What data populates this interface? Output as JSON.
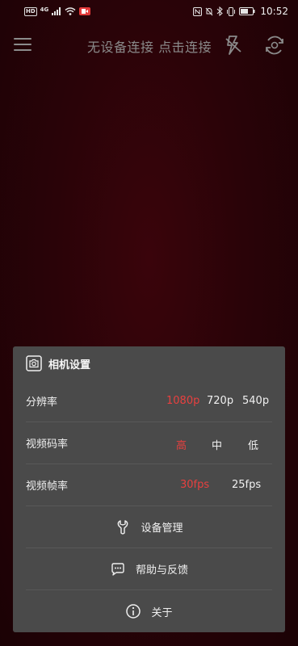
{
  "status": {
    "hd": "HD",
    "signal": "4G",
    "time": "10:52"
  },
  "top": {
    "connection_text": "无设备连接 点击连接",
    "icons": [
      "menu-icon",
      "flash-off-icon",
      "camera-flip-icon"
    ]
  },
  "panel": {
    "title": "相机设置",
    "resolution": {
      "label": "分辨率",
      "options": [
        "1080p",
        "720p",
        "540p"
      ],
      "selected": "1080p"
    },
    "bitrate": {
      "label": "视频码率",
      "options": [
        "高",
        "中",
        "低"
      ],
      "selected": "高"
    },
    "framerate": {
      "label": "视频帧率",
      "options": [
        "30fps",
        "25fps"
      ],
      "selected": "30fps"
    },
    "actions": [
      {
        "label": "设备管理",
        "icon": "wrench-icon"
      },
      {
        "label": "帮助与反馈",
        "icon": "chat-help-icon"
      },
      {
        "label": "关于",
        "icon": "info-icon"
      }
    ]
  },
  "colors": {
    "accent": "#e8403f",
    "panel_bg": "#4a4a4a",
    "bg": "#2a0308"
  }
}
